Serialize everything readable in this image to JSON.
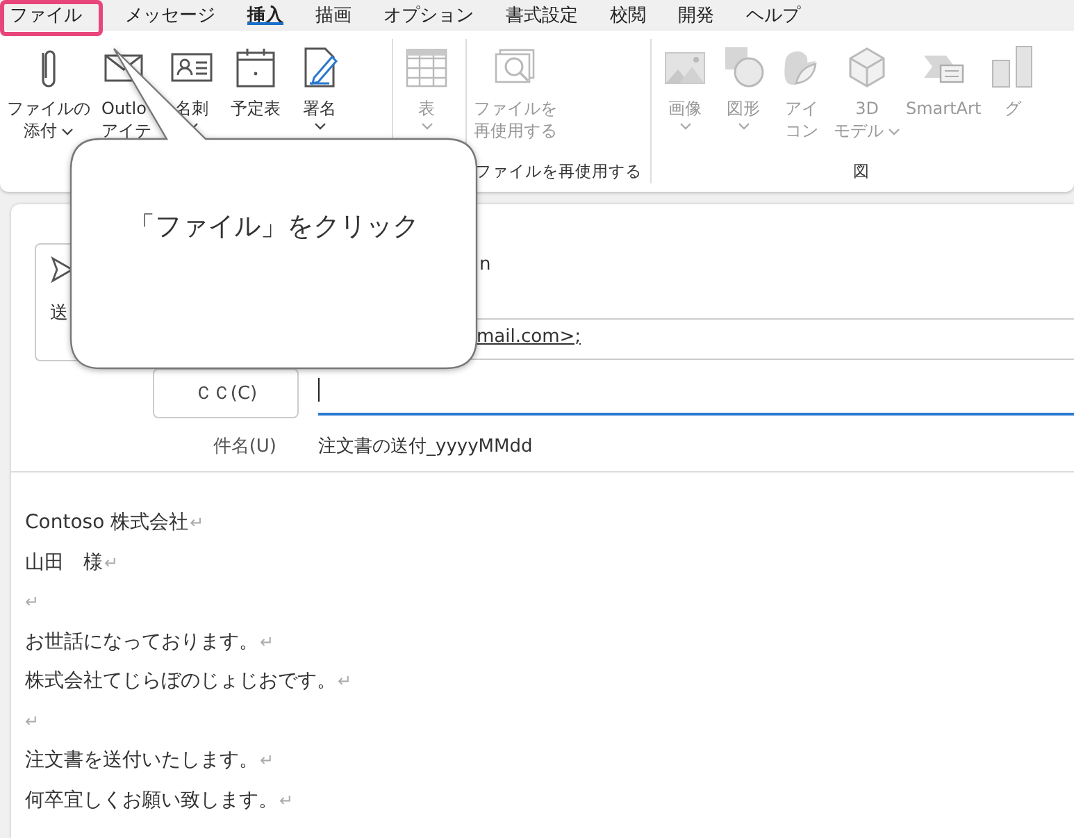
{
  "tabs": [
    {
      "label": "ファイル",
      "selected": false,
      "highlighted": true
    },
    {
      "label": "メッセージ",
      "selected": false,
      "highlighted": false
    },
    {
      "label": "挿入",
      "selected": true,
      "highlighted": false
    },
    {
      "label": "描画",
      "selected": false,
      "highlighted": false
    },
    {
      "label": "オプション",
      "selected": false,
      "highlighted": false
    },
    {
      "label": "書式設定",
      "selected": false,
      "highlighted": false
    },
    {
      "label": "校閲",
      "selected": false,
      "highlighted": false
    },
    {
      "label": "開発",
      "selected": false,
      "highlighted": false
    },
    {
      "label": "ヘルプ",
      "selected": false,
      "highlighted": false
    }
  ],
  "ribbon_groups": [
    {
      "items": [
        {
          "kind": "clip",
          "label": [
            "ファイルの",
            "添付"
          ],
          "dropdown": true,
          "disabled": false
        },
        {
          "kind": "envelope",
          "label": [
            "Outlo",
            "アイテ"
          ],
          "dropdown": false,
          "disabled": false
        },
        {
          "kind": "card",
          "label": [
            "名刺"
          ],
          "dropdown": true,
          "disabled": false
        },
        {
          "kind": "calendar",
          "label": [
            "予定表"
          ],
          "dropdown": false,
          "disabled": false
        },
        {
          "kind": "signature",
          "label": [
            "署名"
          ],
          "dropdown": true,
          "disabled": false
        }
      ]
    },
    {
      "items": [
        {
          "kind": "table",
          "label": [
            "表"
          ],
          "dropdown": true,
          "disabled": true
        }
      ]
    },
    {
      "label": "ファイルを再使用する",
      "items": [
        {
          "kind": "reuse",
          "label": [
            "ファイルを",
            "再使用する"
          ],
          "dropdown": false,
          "disabled": true
        }
      ]
    },
    {
      "label": "図",
      "items": [
        {
          "kind": "image",
          "label": [
            "画像"
          ],
          "dropdown": true,
          "disabled": true
        },
        {
          "kind": "shapes",
          "label": [
            "図形"
          ],
          "dropdown": true,
          "disabled": true
        },
        {
          "kind": "icons",
          "label": [
            "アイ",
            "コン"
          ],
          "dropdown": false,
          "disabled": true
        },
        {
          "kind": "cube",
          "label": [
            "3D",
            "モデル"
          ],
          "dropdown": true,
          "disabled": true
        },
        {
          "kind": "smartart",
          "label": [
            "SmartArt"
          ],
          "dropdown": false,
          "disabled": true
        },
        {
          "kind": "chart",
          "label": [
            "グ"
          ],
          "dropdown": false,
          "disabled": true
        }
      ]
    }
  ],
  "header": {
    "send_button": "送",
    "from": "n",
    "to": "mail.com>;",
    "cc_button": "ＣＣ(C)",
    "subject_label": "件名(U)",
    "subject": "注文書の送付_yyyyMMdd"
  },
  "body": [
    {
      "text": "Contoso 株式会社",
      "mark": "↵"
    },
    {
      "text": "山田　様",
      "mark": "↵"
    },
    {
      "mark": "↵"
    },
    {
      "text": "お世話になっております。",
      "mark": "↵"
    },
    {
      "text": "株式会社てじらぼのじょじおです。",
      "mark": "↵"
    },
    {
      "mark": "↵"
    },
    {
      "text": "注文書を送付いたします。",
      "mark": "↵"
    },
    {
      "text": "何卒宜しくお願い致します。",
      "mark": "↵"
    }
  ],
  "callout": {
    "text": "「ファイル」をクリック"
  }
}
